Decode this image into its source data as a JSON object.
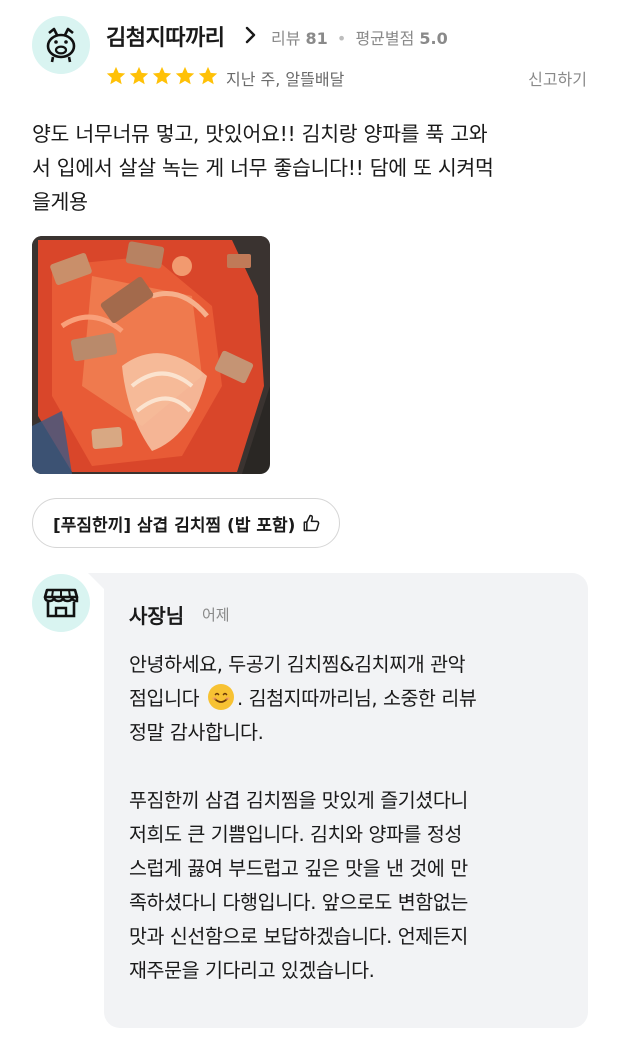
{
  "review": {
    "user_name": "김첨지따까리",
    "review_count_label": "리뷰",
    "review_count": "81",
    "avg_rating_label": "평균별점",
    "avg_rating": "5.0",
    "rating": 5,
    "posted_when": "지난 주, 알뜰배달",
    "report_label": "신고하기",
    "text_lines": [
      "양도 너무너뮤 멓고, 맛있어요!! 김치랑 양파를 푹 고와",
      "서 입에서 살살 녹는 게 너무 좋습니다!! 담에 또 시켜먹",
      "을게용"
    ],
    "menu_chip": "[푸짐한끼] 삼겹 김치찜 (밥 포함)",
    "star_color": "#ffc107"
  },
  "owner_reply": {
    "name": "사장님",
    "when": "어제",
    "para1_line1": "안녕하세요, 두공기 김치찜&김치찌개 관악",
    "para1_line2_pre": "점입니다",
    "para1_line2_post": ". 김첨지따까리님, 소중한 리뷰",
    "para1_line3": "정말 감사합니다.",
    "para2_lines": [
      "푸짐한끼 삼겹 김치찜을 맛있게 즐기셨다니",
      "저희도 큰 기쁨입니다. 김치와 양파를 정성",
      "스럽게 끓여 부드럽고 깊은 맛을 낸 것에 만",
      "족하셨다니 다행입니다. 앞으로도 변함없는",
      "맛과 신선함으로 보답하겠습니다. 언제든지",
      "재주문을 기다리고 있겠습니다."
    ]
  }
}
